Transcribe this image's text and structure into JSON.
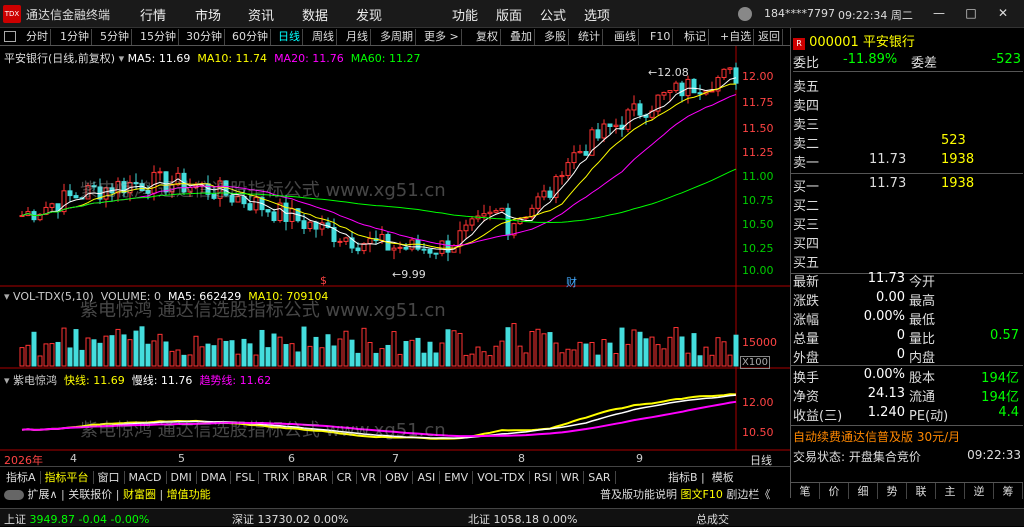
{
  "app": {
    "title": "通达信金融终端",
    "logo": "TDX"
  },
  "menu": [
    "行情",
    "市场",
    "资讯",
    "数据",
    "发现",
    "功能",
    "版面",
    "公式",
    "选项"
  ],
  "user": "184****7797",
  "clock": "09:22:34 周二",
  "periods": [
    "分时",
    "1分钟",
    "5分钟",
    "15分钟",
    "30分钟",
    "60分钟",
    "日线",
    "周线",
    "月线",
    "多周期",
    "更多 >"
  ],
  "tools": [
    "复权",
    "叠加",
    "多股",
    "统计",
    "画线",
    "F10",
    "标记",
    "+自选",
    "返回"
  ],
  "chart": {
    "title": "平安银行(日线,前复权)",
    "ma": [
      {
        "t": "MA5: 11.69",
        "c": "#ffffff"
      },
      {
        "t": "MA10: 11.74",
        "c": "#ffff00"
      },
      {
        "t": "MA20: 11.76",
        "c": "#ff00ff"
      },
      {
        "t": "MA60: 11.27",
        "c": "#00ff00"
      }
    ],
    "price_ticks": [
      "12.08",
      "12.00",
      "11.75",
      "11.50",
      "11.25",
      "11.00",
      "10.75",
      "10.50",
      "10.25",
      "10.00"
    ],
    "high_label": "12.08",
    "low_label": "9.99",
    "marks": [
      "$",
      "财"
    ],
    "vol_line": [
      {
        "t": "VOL-TDX(5,10)",
        "c": "#ccc"
      },
      {
        "t": "VOLUME: 0",
        "c": "#ccc"
      },
      {
        "t": "MA5: 662429",
        "c": "#ffffff"
      },
      {
        "t": "MA10: 709104",
        "c": "#ffff00"
      }
    ],
    "vol_ticks": [
      "15000",
      "X100"
    ],
    "ind_line": [
      {
        "t": "紫电惊鸿",
        "c": "#ccc"
      },
      {
        "t": "快线: 11.69",
        "c": "#ffff00"
      },
      {
        "t": "慢线: 11.76",
        "c": "#ffffff"
      },
      {
        "t": "趋势线: 11.62",
        "c": "#ff00ff"
      }
    ],
    "ind_ticks": [
      "12.00",
      "10.50"
    ],
    "dates": [
      "2026年",
      "4",
      "5",
      "6",
      "7",
      "8",
      "9"
    ],
    "period_label": "日线",
    "watermark": "紫电惊鸿 通达信选股指标公式 www.xg51.cn"
  },
  "chart_data": {
    "type": "candlestick",
    "ylim": [
      9.9,
      12.2
    ],
    "note": "daily candles"
  },
  "tabs1": [
    "指标A",
    "指标平台",
    "窗口",
    "MACD",
    "DMI",
    "DMA",
    "FSL",
    "TRIX",
    "BRAR",
    "CR",
    "VR",
    "OBV",
    "ASI",
    "EMV",
    "VOL-TDX",
    "RSI",
    "WR",
    "SAR"
  ],
  "tabs1_right": [
    "指标B",
    "模板"
  ],
  "tabs2": [
    "扩展∧",
    "关联报价",
    "财富圈",
    "增值功能"
  ],
  "tabs2_right": [
    "普及版功能说明",
    "图文F10",
    "剧边栏《"
  ],
  "quote": {
    "code": "000001",
    "name": "平安银行",
    "webi": "委比",
    "webi_v": "-11.89%",
    "wecha": "委差",
    "wecha_v": "-523",
    "sells": [
      {
        "l": "卖五",
        "p": "",
        "v": ""
      },
      {
        "l": "卖四",
        "p": "",
        "v": ""
      },
      {
        "l": "卖三",
        "p": "",
        "v": ""
      },
      {
        "l": "卖二",
        "p": "",
        "v": "523"
      },
      {
        "l": "卖一",
        "p": "11.73",
        "v": "1938"
      }
    ],
    "buys": [
      {
        "l": "买一",
        "p": "11.73",
        "v": "1938"
      },
      {
        "l": "买二",
        "p": "",
        "v": ""
      },
      {
        "l": "买三",
        "p": "",
        "v": ""
      },
      {
        "l": "买四",
        "p": "",
        "v": ""
      },
      {
        "l": "买五",
        "p": "",
        "v": ""
      }
    ],
    "stats": [
      {
        "a": "最新",
        "av": "11.73",
        "b": "今开",
        "bv": ""
      },
      {
        "a": "涨跌",
        "av": "0.00",
        "b": "最高",
        "bv": ""
      },
      {
        "a": "涨幅",
        "av": "0.00%",
        "b": "最低",
        "bv": ""
      },
      {
        "a": "总量",
        "av": "0",
        "b": "量比",
        "bv": "0.57"
      },
      {
        "a": "外盘",
        "av": "0",
        "b": "内盘",
        "bv": ""
      }
    ],
    "stats2": [
      {
        "a": "换手",
        "av": "0.00%",
        "b": "股本",
        "bv": "194亿"
      },
      {
        "a": "净资",
        "av": "24.13",
        "b": "流通",
        "bv": "194亿"
      },
      {
        "a": "收益(三)",
        "av": "1.240",
        "b": "PE(动)",
        "bv": "4.4"
      }
    ],
    "promo": "自动续费通达信普及版 30元/月",
    "trade_state": "交易状态: 开盘集合竞价",
    "trade_time": "09:22:33",
    "bottom_tabs": [
      "笔",
      "价",
      "细",
      "势",
      "联",
      "主",
      "逆",
      "筹"
    ]
  },
  "status": {
    "sh": "上证",
    "sh_v": "3949.87",
    "sh_c": "-0.04",
    "sh_p": "-0.00%",
    "sz": "深证",
    "sz_v": "13730.02",
    "sz_p": "0.00%",
    "bj": "北证",
    "bj_v": "1058.18",
    "bj_p": "0.00%",
    "right": "总成交"
  }
}
